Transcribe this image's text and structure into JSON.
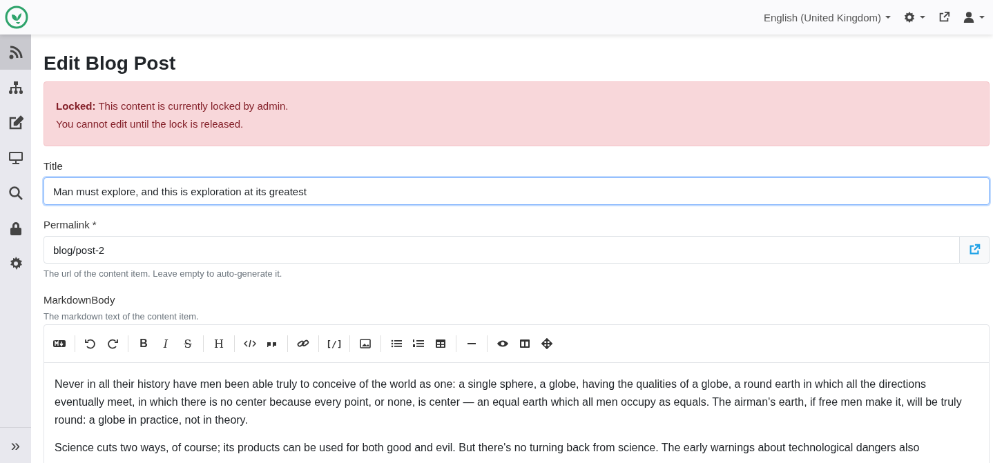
{
  "topbar": {
    "language": "English (United Kingdom)"
  },
  "sidebar": {
    "items": [
      {
        "kind": "feed",
        "selected": true
      },
      {
        "kind": "tree",
        "selected": false
      },
      {
        "kind": "edit",
        "selected": false
      },
      {
        "kind": "monitor",
        "selected": false
      },
      {
        "kind": "search",
        "selected": false
      },
      {
        "kind": "lock",
        "selected": false
      },
      {
        "kind": "settings",
        "selected": false
      }
    ],
    "toggle": "»"
  },
  "page": {
    "title": "Edit Blog Post"
  },
  "alert": {
    "text": "**Locked:** This content is currently locked by admin.",
    "text_2": "You cannot edit until the lock is released."
  },
  "fields": [
    {
      "kind": "text",
      "label": "Title",
      "value": "Man must explore, and this is exploration at its greatest",
      "focused": true
    },
    {
      "kind": "link",
      "label": "Permalink *",
      "value": "blog/post-2",
      "hint": "The url of the content item. Leave empty to auto-generate it."
    }
  ],
  "markdown": {
    "label": "MarkdownBody",
    "hint": "The markdown text of the content item.",
    "toolbar": [
      [
        {
          "kind": "md"
        }
      ],
      [
        {
          "kind": "undo"
        },
        {
          "kind": "redo"
        }
      ],
      [
        {
          "kind": "bold",
          "glyph": "B"
        },
        {
          "kind": "italic",
          "glyph": "I"
        },
        {
          "kind": "strike",
          "glyph": "S"
        }
      ],
      [
        {
          "kind": "heading",
          "glyph": "H"
        }
      ],
      [
        {
          "kind": "code"
        },
        {
          "kind": "quote"
        }
      ],
      [
        {
          "kind": "link"
        }
      ],
      [
        {
          "kind": "shortcode",
          "glyph": "[/]"
        }
      ],
      [
        {
          "kind": "image"
        }
      ],
      [
        {
          "kind": "ul"
        },
        {
          "kind": "ol"
        },
        {
          "kind": "table"
        }
      ],
      [
        {
          "kind": "hr"
        }
      ],
      [
        {
          "kind": "preview"
        },
        {
          "kind": "columns"
        },
        {
          "kind": "fullscreen"
        }
      ]
    ],
    "paragraphs": [
      "Never in all their history have men been able truly to conceive of the world as one: a single sphere, a globe, having the qualities of a globe, a round earth in which all the directions eventually meet, in which there is no center because every point, or none, is center — an equal earth which all men occupy as equals. The airman's earth, if free men make it, will be truly round: a globe in practice, not in theory.",
      "Science cuts two ways, of course; its products can be used for both good and evil. But there's no turning back from science. The early warnings about technological dangers also"
    ]
  }
}
